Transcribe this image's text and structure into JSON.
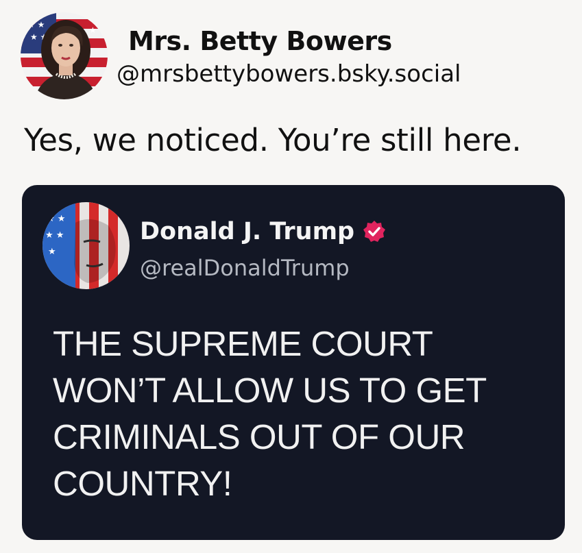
{
  "post": {
    "author_name": "Mrs. Betty Bowers",
    "author_handle": "@mrsbettybowers.bsky.social",
    "text": "Yes, we noticed. You’re still here."
  },
  "quoted_post": {
    "author_name": "Donald J. Trump",
    "author_handle": "@realDonaldTrump",
    "verified": true,
    "text_lines": [
      "THE SUPREME COURT",
      "WON’T ALLOW US TO GET",
      "CRIMINALS OUT OF OUR",
      "COUNTRY!"
    ]
  },
  "colors": {
    "background": "#f7f6f4",
    "quote_card": "#131725",
    "verified_badge": "#e0245e"
  },
  "icons": {
    "verified": "verified-badge-icon"
  }
}
